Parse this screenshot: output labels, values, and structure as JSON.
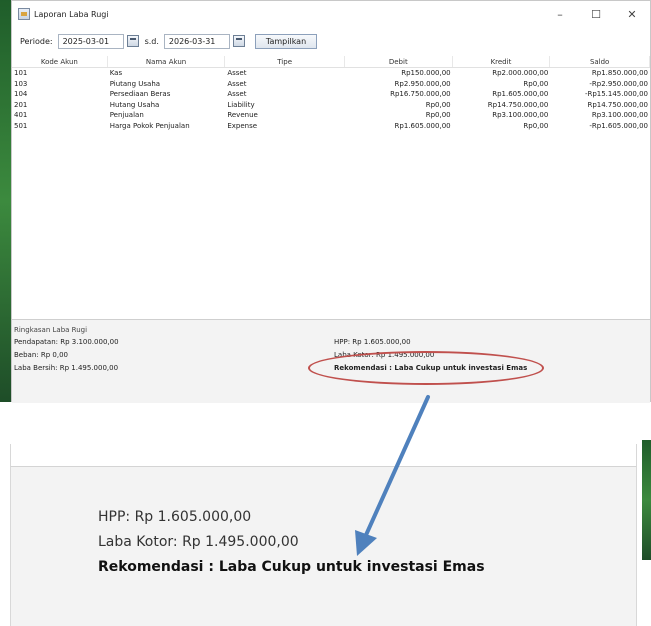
{
  "window": {
    "title": "Laporan Laba Rugi",
    "minimize": "–",
    "maximize": "☐",
    "close": "✕"
  },
  "toolbar": {
    "periode_label": "Periode:",
    "start_date": "2025-03-01",
    "sd_label": "s.d.",
    "end_date": "2026-03-31",
    "show_button": "Tampilkan"
  },
  "table": {
    "headers": [
      "Kode Akun",
      "Nama Akun",
      "Tipe",
      "Debit",
      "Kredit",
      "Saldo"
    ],
    "rows": [
      [
        "101",
        "Kas",
        "Asset",
        "Rp150.000,00",
        "Rp2.000.000,00",
        "Rp1.850.000,00"
      ],
      [
        "103",
        "Piutang Usaha",
        "Asset",
        "Rp2.950.000,00",
        "Rp0,00",
        "-Rp2.950.000,00"
      ],
      [
        "104",
        "Persediaan Beras",
        "Asset",
        "Rp16.750.000,00",
        "Rp1.605.000,00",
        "-Rp15.145.000,00"
      ],
      [
        "201",
        "Hutang Usaha",
        "Liability",
        "Rp0,00",
        "Rp14.750.000,00",
        "Rp14.750.000,00"
      ],
      [
        "401",
        "Penjualan",
        "Revenue",
        "Rp0,00",
        "Rp3.100.000,00",
        "Rp3.100.000,00"
      ],
      [
        "501",
        "Harga Pokok Penjualan",
        "Expense",
        "Rp1.605.000,00",
        "Rp0,00",
        "-Rp1.605.000,00"
      ]
    ]
  },
  "summary": {
    "heading": "Ringkasan Laba Rugi",
    "pendapatan": "Pendapatan: Rp 3.100.000,00",
    "beban": "Beban: Rp 0,00",
    "laba_bersih": "Laba Bersih: Rp 1.495.000,00",
    "hpp": "HPP: Rp 1.605.000,00",
    "laba_kotor": "Laba Kotor: Rp 1.495.000,00",
    "rekomendasi": "Rekomendasi : Laba Cukup untuk investasi Emas"
  },
  "colors": {
    "highlight_ellipse": "#c0504d",
    "arrow": "#4f81bd"
  }
}
